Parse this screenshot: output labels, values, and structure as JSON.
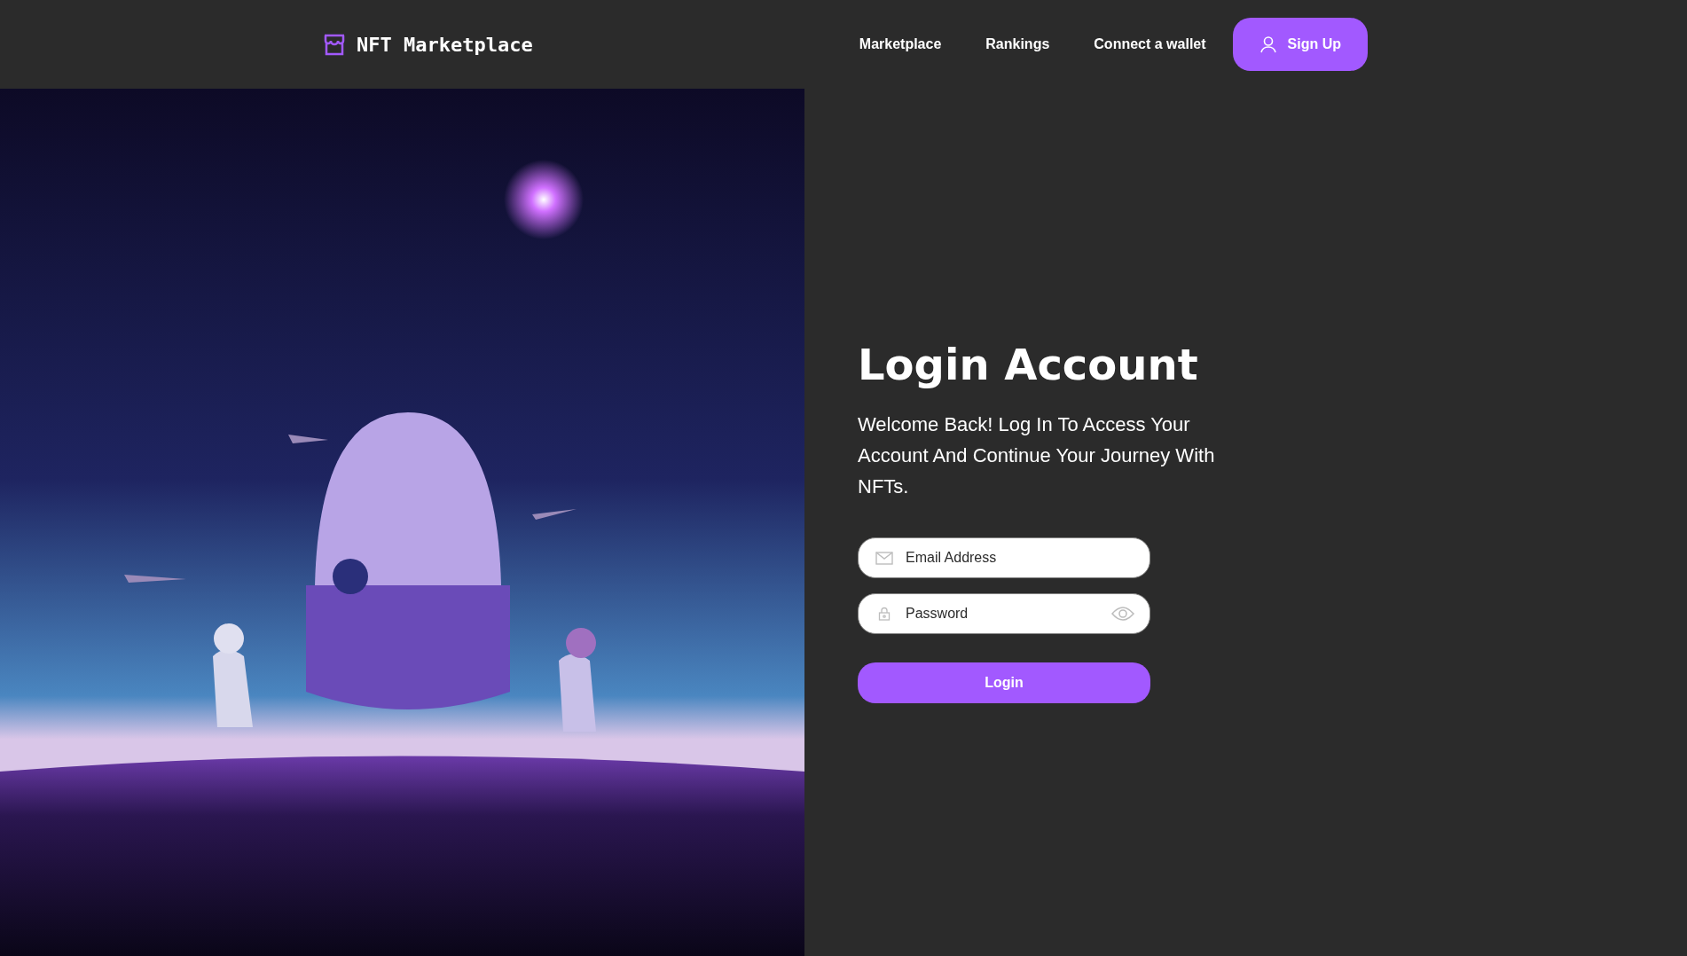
{
  "header": {
    "logo": "NFT Marketplace",
    "nav": [
      {
        "label": "Marketplace"
      },
      {
        "label": "Rankings"
      },
      {
        "label": "Connect a wallet"
      }
    ],
    "sign_up": "Sign Up"
  },
  "login": {
    "title": "Login Account",
    "description": "Welcome Back! Log In To Access Your Account And Continue Your Journey With NFTs.",
    "fields": [
      {
        "kind": "email",
        "placeholder": "Email Address"
      },
      {
        "kind": "password",
        "placeholder": "Password"
      }
    ],
    "button": "Login"
  }
}
